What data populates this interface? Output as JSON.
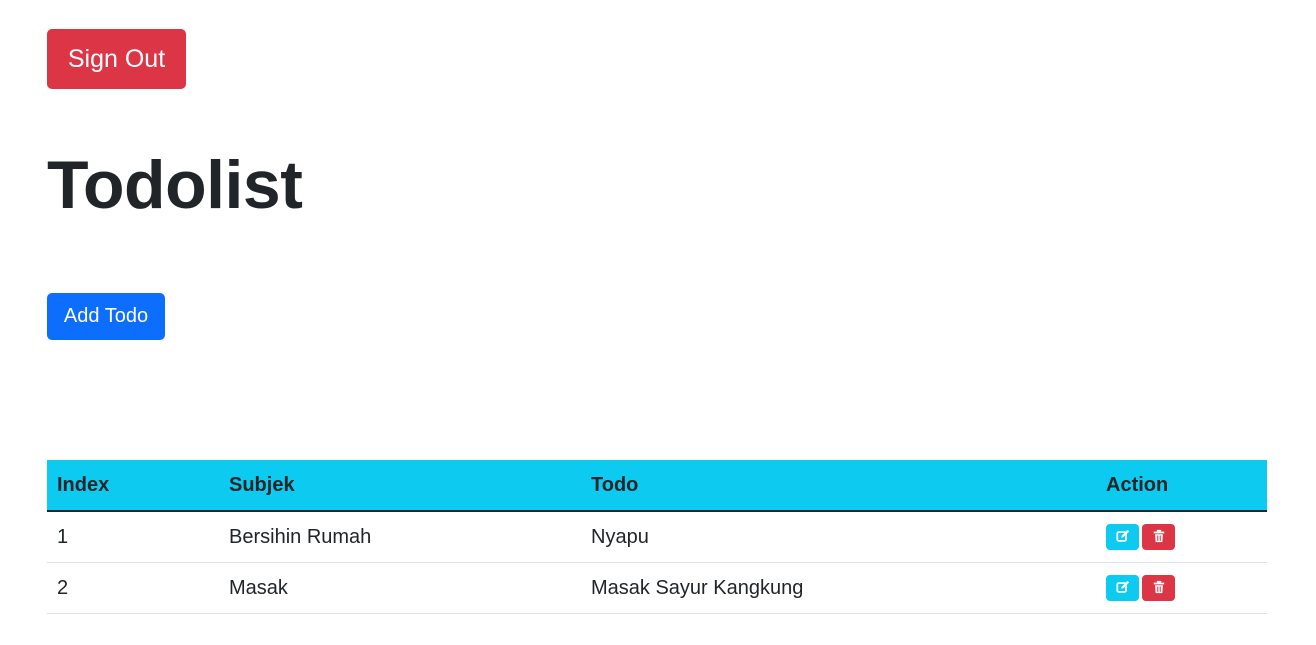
{
  "header": {
    "sign_out_label": "Sign Out",
    "title": "Todolist",
    "add_todo_label": "Add Todo"
  },
  "table": {
    "columns": [
      "Index",
      "Subjek",
      "Todo",
      "Action"
    ],
    "rows": [
      {
        "index": "1",
        "subjek": "Bersihin Rumah",
        "todo": "Nyapu"
      },
      {
        "index": "2",
        "subjek": "Masak",
        "todo": "Masak Sayur Kangkung"
      }
    ]
  },
  "icons": {
    "edit": "edit-icon",
    "delete": "trash-icon"
  },
  "colors": {
    "danger": "#dc3545",
    "primary": "#0d6efd",
    "info": "#0dcaf0",
    "text": "#212529"
  }
}
